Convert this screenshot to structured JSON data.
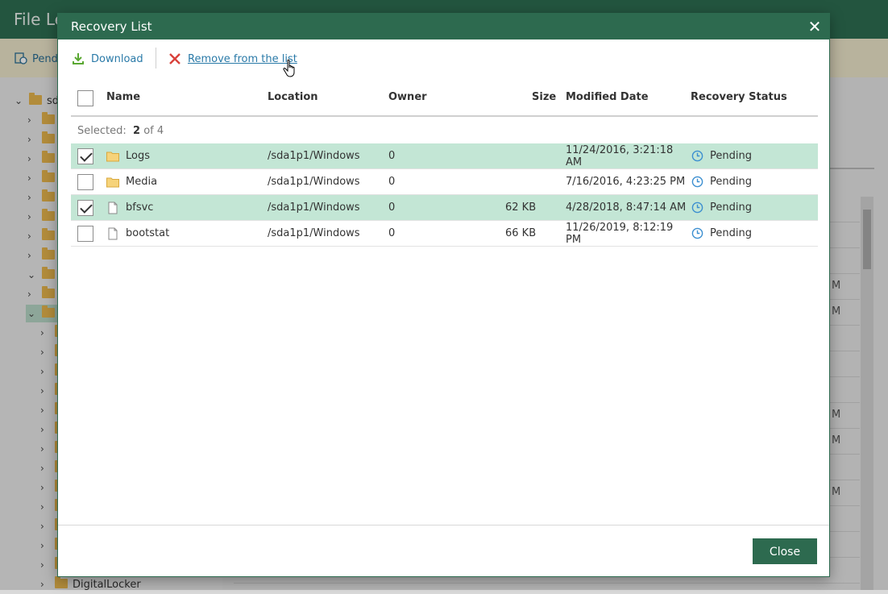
{
  "app": {
    "title": "File Le",
    "toolbar_label": "Pend",
    "tree_label_root": "sd",
    "tree_label_last": "DigitalLocker",
    "bg_modified_fragments": [
      "M",
      "M",
      "M",
      "M",
      "M"
    ]
  },
  "dialog": {
    "title": "Recovery List",
    "toolbar": {
      "download_label": "Download",
      "remove_label": "Remove from the list"
    },
    "columns": {
      "name": "Name",
      "location": "Location",
      "owner": "Owner",
      "size": "Size",
      "modified": "Modified Date",
      "status": "Recovery Status"
    },
    "selected_label": "Selected:",
    "selected_count": "2",
    "selected_of": "of 4",
    "rows": [
      {
        "name": "Logs",
        "type": "folder",
        "location": "/sda1p1/Windows",
        "owner": "0",
        "size": "",
        "modified": "11/24/2016, 3:21:18 AM",
        "status": "Pending",
        "checked": true
      },
      {
        "name": "Media",
        "type": "folder",
        "location": "/sda1p1/Windows",
        "owner": "0",
        "size": "",
        "modified": "7/16/2016, 4:23:25 PM",
        "status": "Pending",
        "checked": false
      },
      {
        "name": "bfsvc",
        "type": "file",
        "location": "/sda1p1/Windows",
        "owner": "0",
        "size": "62 KB",
        "modified": "4/28/2018, 8:47:14 AM",
        "status": "Pending",
        "checked": true
      },
      {
        "name": "bootstat",
        "type": "file",
        "location": "/sda1p1/Windows",
        "owner": "0",
        "size": "66 KB",
        "modified": "11/26/2019, 8:12:19 PM",
        "status": "Pending",
        "checked": false
      }
    ],
    "close_label": "Close"
  },
  "colors": {
    "header_green": "#2d6a4f",
    "selected_row": "#c3e6d5",
    "link_blue": "#2a7aa8",
    "remove_red": "#d9413b",
    "download_green": "#5aa832",
    "status_blue": "#3c8fd0"
  },
  "icons": {
    "download": "download-icon",
    "remove": "x-icon",
    "folder": "folder-icon",
    "file": "file-icon",
    "status": "clock-icon",
    "close": "close-icon"
  }
}
